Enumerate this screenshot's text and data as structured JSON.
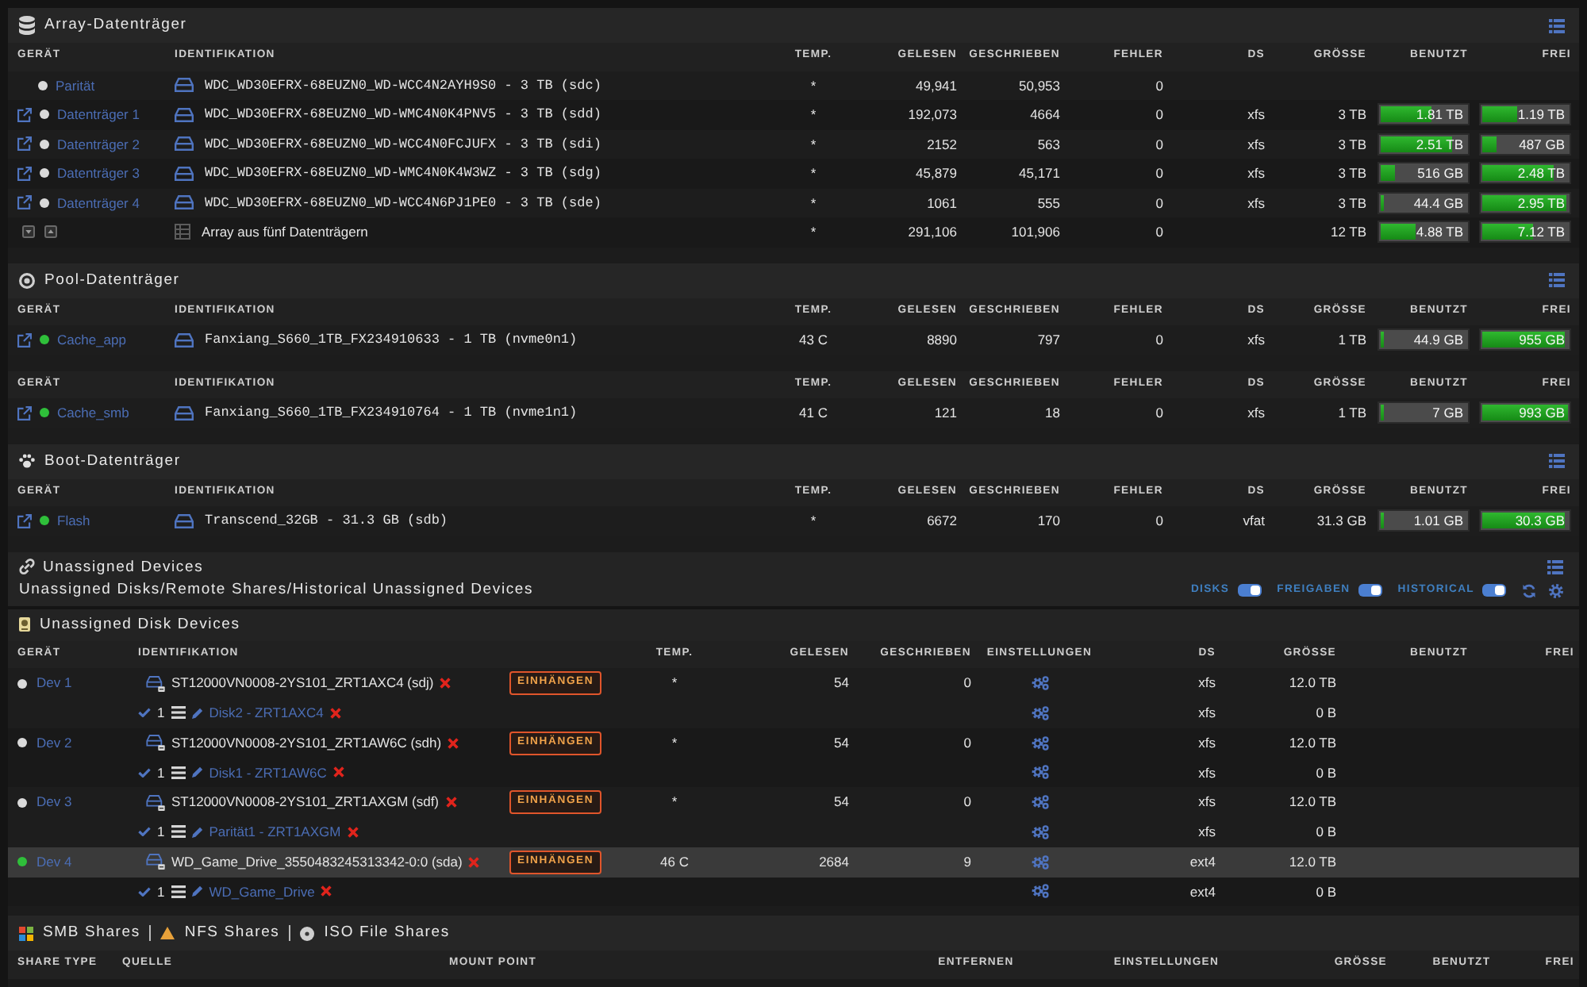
{
  "array": {
    "title": "Array-Datenträger",
    "columns": [
      "GERÄT",
      "IDENTIFIKATION",
      "TEMP.",
      "GELESEN",
      "GESCHRIEBEN",
      "FEHLER",
      "DS",
      "GRÖSSE",
      "BENUTZT",
      "FREI"
    ],
    "rows": [
      {
        "kind": "parity",
        "color": "#dadada",
        "device": "Parität",
        "identification": "WDC_WD30EFRX-68EUZN0_WD-WCC4N2AYH9S0 - 3 TB (sdc)",
        "temp": "*",
        "read": "49,941",
        "written": "50,953",
        "errors": "0"
      },
      {
        "kind": "disk",
        "color": "#dadada",
        "device": "Datenträger 1",
        "identification": "WDC_WD30EFRX-68EUZN0_WD-WMC4N0K4PNV5 - 3 TB (sdd)",
        "temp": "*",
        "read": "192,073",
        "written": "4664",
        "errors": "0",
        "fs": "xfs",
        "size": "3 TB",
        "used": {
          "text": "1.81 TB",
          "level": 0.6
        },
        "free": {
          "text": "1.19 TB",
          "level": 0.4
        }
      },
      {
        "kind": "disk",
        "color": "#dadada",
        "device": "Datenträger 2",
        "identification": "WDC_WD30EFRX-68EUZN0_WD-WCC4N0FCJUFX - 3 TB (sdi)",
        "temp": "*",
        "read": "2152",
        "written": "563",
        "errors": "0",
        "fs": "xfs",
        "size": "3 TB",
        "used": {
          "text": "2.51 TB",
          "level": 0.84
        },
        "free": {
          "text": "487 GB",
          "level": 0.16
        }
      },
      {
        "kind": "disk",
        "color": "#dadada",
        "device": "Datenträger 3",
        "identification": "WDC_WD30EFRX-68EUZN0_WD-WMC4N0K4W3WZ - 3 TB (sdg)",
        "temp": "*",
        "read": "45,879",
        "written": "45,171",
        "errors": "0",
        "fs": "xfs",
        "size": "3 TB",
        "used": {
          "text": "516 GB",
          "level": 0.17
        },
        "free": {
          "text": "2.48 TB",
          "level": 0.83
        }
      },
      {
        "kind": "disk",
        "color": "#dadada",
        "device": "Datenträger 4",
        "identification": "WDC_WD30EFRX-68EUZN0_WD-WCC4N6PJ1PE0 - 3 TB (sde)",
        "temp": "*",
        "read": "1061",
        "written": "555",
        "errors": "0",
        "fs": "xfs",
        "size": "3 TB",
        "used": {
          "text": "44.4 GB",
          "level": 0.015
        },
        "free": {
          "text": "2.95 TB",
          "level": 0.985
        }
      },
      {
        "kind": "total",
        "identification": "Array aus fünf Datenträgern",
        "temp": "*",
        "read": "291,106",
        "written": "101,906",
        "errors": "0",
        "size": "12 TB",
        "used": {
          "text": "4.88 TB",
          "level": 0.41
        },
        "free": {
          "text": "7.12 TB",
          "level": 0.59
        }
      }
    ]
  },
  "pool": {
    "title": "Pool-Datenträger",
    "pools": [
      {
        "columns": [
          "GERÄT",
          "IDENTIFIKATION",
          "TEMP.",
          "GELESEN",
          "GESCHRIEBEN",
          "FEHLER",
          "DS",
          "GRÖSSE",
          "BENUTZT",
          "FREI"
        ],
        "rows": [
          {
            "kind": "disk",
            "color": "#2fbf3a",
            "device": "Cache_app",
            "identification": "Fanxiang_S660_1TB_FX234910633 - 1 TB (nvme0n1)",
            "temp": "43 C",
            "read": "8890",
            "written": "797",
            "errors": "0",
            "fs": "xfs",
            "size": "1 TB",
            "used": {
              "text": "44.9 GB",
              "level": 0.02
            },
            "free": {
              "text": "955 GB",
              "level": 0.97
            }
          }
        ]
      },
      {
        "columns": [
          "GERÄT",
          "IDENTIFIKATION",
          "TEMP.",
          "GELESEN",
          "GESCHRIEBEN",
          "FEHLER",
          "DS",
          "GRÖSSE",
          "BENUTZT",
          "FREI"
        ],
        "rows": [
          {
            "kind": "disk",
            "color": "#2fbf3a",
            "device": "Cache_smb",
            "identification": "Fanxiang_S660_1TB_FX234910764 - 1 TB (nvme1n1)",
            "temp": "41 C",
            "read": "121",
            "written": "18",
            "errors": "0",
            "fs": "xfs",
            "size": "1 TB",
            "used": {
              "text": "7 GB",
              "level": 0.007
            },
            "free": {
              "text": "993 GB",
              "level": 0.993
            }
          }
        ]
      }
    ]
  },
  "boot": {
    "title": "Boot-Datenträger",
    "columns": [
      "GERÄT",
      "IDENTIFIKATION",
      "TEMP.",
      "GELESEN",
      "GESCHRIEBEN",
      "FEHLER",
      "DS",
      "GRÖSSE",
      "BENUTZT",
      "FREI"
    ],
    "rows": [
      {
        "kind": "disk",
        "color": "#2fbf3a",
        "device": "Flash",
        "identification": "Transcend_32GB - 31.3 GB (sdb)",
        "temp": "*",
        "read": "6672",
        "written": "170",
        "errors": "0",
        "fs": "vfat",
        "size": "31.3 GB",
        "used": {
          "text": "1.01 GB",
          "level": 0.03
        },
        "free": {
          "text": "30.3 GB",
          "level": 0.97
        }
      }
    ]
  },
  "unassigned": {
    "title": "Unassigned Devices",
    "subtitle": "Unassigned Disks/Remote Shares/Historical Unassigned Devices",
    "toggles": [
      {
        "label": "DISKS",
        "on": true
      },
      {
        "label": "FREIGABEN",
        "on": true
      },
      {
        "label": "HISTORICAL",
        "on": true
      }
    ],
    "disk_devices": {
      "title": "Unassigned Disk Devices",
      "columns": [
        "GERÄT",
        "IDENTIFIKATION",
        "TEMP.",
        "GELESEN",
        "GESCHRIEBEN",
        "EINSTELLUNGEN",
        "DS",
        "GRÖSSE",
        "BENUTZT",
        "FREI"
      ],
      "devices": [
        {
          "name": "Dev 1",
          "color": "#dadada",
          "highlighted": false,
          "identification": "ST12000VN0008-2YS101_ZRT1AXC4 (sdj)",
          "action": "EINHÄNGEN",
          "temp": "*",
          "read": "54",
          "written": "0",
          "fs": "xfs",
          "size": "12.0 TB",
          "partitions": [
            {
              "number": "1",
              "label": "Disk2 - ZRT1AXC4",
              "fs": "xfs",
              "size": "0 B"
            }
          ]
        },
        {
          "name": "Dev 2",
          "color": "#dadada",
          "highlighted": false,
          "identification": "ST12000VN0008-2YS101_ZRT1AW6C (sdh)",
          "action": "EINHÄNGEN",
          "temp": "*",
          "read": "54",
          "written": "0",
          "fs": "xfs",
          "size": "12.0 TB",
          "partitions": [
            {
              "number": "1",
              "label": "Disk1 - ZRT1AW6C",
              "fs": "xfs",
              "size": "0 B"
            }
          ]
        },
        {
          "name": "Dev 3",
          "color": "#dadada",
          "highlighted": false,
          "identification": "ST12000VN0008-2YS101_ZRT1AXGM (sdf)",
          "action": "EINHÄNGEN",
          "temp": "*",
          "read": "54",
          "written": "0",
          "fs": "xfs",
          "size": "12.0 TB",
          "partitions": [
            {
              "number": "1",
              "label": "Parität1 - ZRT1AXGM",
              "fs": "xfs",
              "size": "0 B"
            }
          ]
        },
        {
          "name": "Dev 4",
          "color": "#2fbf3a",
          "highlighted": true,
          "identification": "WD_Game_Drive_3550483245313342-0:0 (sda)",
          "action": "EINHÄNGEN",
          "temp": "46 C",
          "read": "2684",
          "written": "9",
          "fs": "ext4",
          "size": "12.0 TB",
          "partitions": [
            {
              "number": "1",
              "label": "WD_Game_Drive",
              "fs": "ext4",
              "size": "0 B"
            }
          ]
        }
      ]
    }
  },
  "shares": {
    "headings": [
      {
        "kind": "smb",
        "label": "SMB Shares"
      },
      {
        "kind": "nfs",
        "label": "NFS Shares"
      },
      {
        "kind": "iso",
        "label": "ISO File Shares"
      }
    ],
    "columns": [
      "SHARE TYPE",
      "QUELLE",
      "MOUNT POINT",
      "ENTFERNEN",
      "EINSTELLUNGEN",
      "GRÖSSE",
      "BENUTZT",
      "FREI"
    ]
  }
}
